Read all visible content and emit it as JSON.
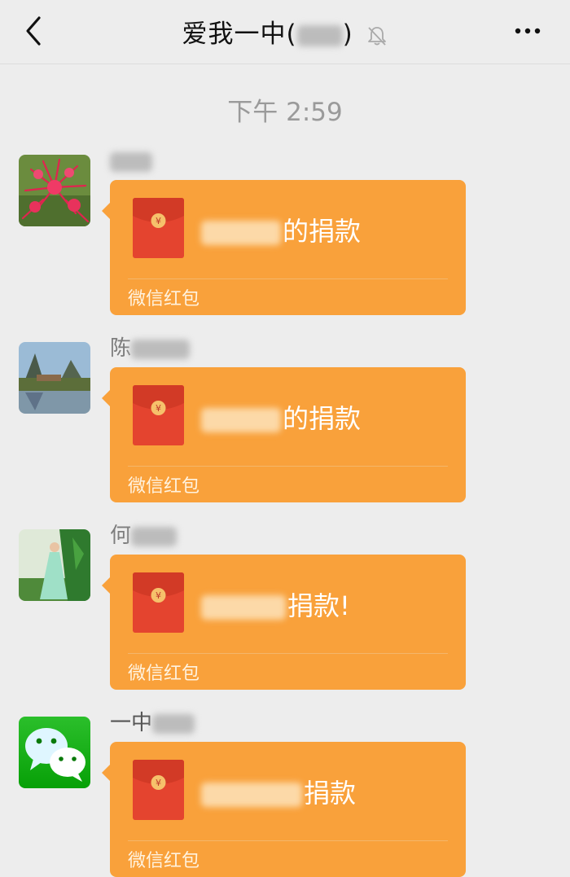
{
  "header": {
    "title": "爱我一中(",
    "title_suffix": ")"
  },
  "timestamp": "下午 2:59",
  "icons": {
    "back": "chevron-left-icon",
    "mute": "bell-off-icon",
    "more": "ellipsis-icon",
    "red_packet": "red-envelope-icon"
  },
  "colors": {
    "packet_orange": "#f9a13b",
    "envelope_red": "#e4442f",
    "envelope_seal": "#f6c16b"
  },
  "messages": [
    {
      "sender": "",
      "remark": "的捐款",
      "footer": "微信红包",
      "envelope_symbol": "¥"
    },
    {
      "sender": "陈",
      "remark": "的捐款",
      "footer": "微信红包",
      "envelope_symbol": "¥"
    },
    {
      "sender": "何",
      "remark": "捐款!",
      "footer": "微信红包",
      "envelope_symbol": "¥"
    },
    {
      "sender": "一中",
      "remark": "捐款",
      "footer": "微信红包",
      "envelope_symbol": "¥"
    }
  ]
}
